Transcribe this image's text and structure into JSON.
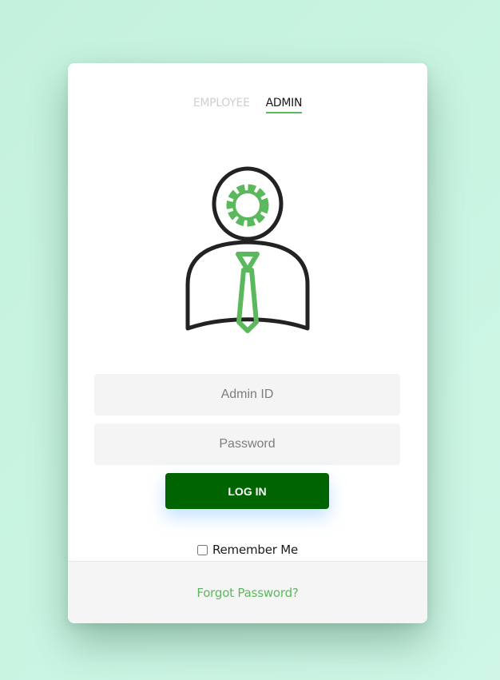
{
  "tabs": [
    {
      "label": "EMPLOYEE",
      "active": false
    },
    {
      "label": "ADMIN",
      "active": true
    }
  ],
  "avatar": {
    "icon": "admin-user-gear-icon",
    "colors": {
      "outline": "#222222",
      "accent": "#5cb85c"
    }
  },
  "form": {
    "admin_id": {
      "placeholder": "Admin ID",
      "value": ""
    },
    "password": {
      "placeholder": "Password",
      "value": ""
    },
    "login_label": "LOG IN",
    "remember_label": "Remember Me",
    "remember_checked": false
  },
  "footer": {
    "forgot_label": "Forgot Password?"
  },
  "colors": {
    "background": "#c9f4e2",
    "button": "#006400",
    "accent": "#5cb85c"
  }
}
